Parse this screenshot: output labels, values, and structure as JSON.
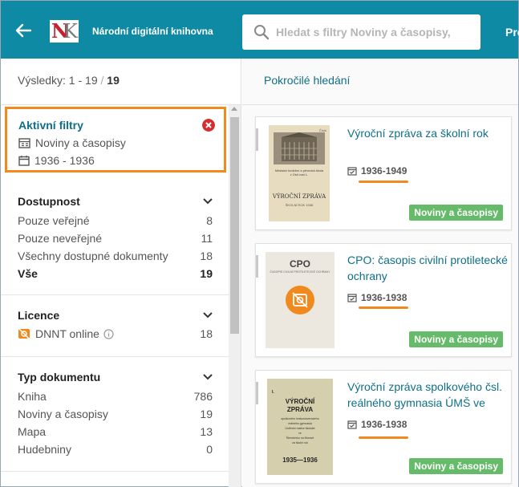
{
  "header": {
    "brand": "Národní digitální knihovna",
    "search_placeholder": "Hledat s filtry Noviny a časopisy,",
    "profile_label": "Pro"
  },
  "results": {
    "prefix": "Výsledky: 1 - 19",
    "separator": "/",
    "total": "19"
  },
  "advanced_search": "Pokročilé hledání",
  "active_filters": {
    "title": "Aktivní filtry",
    "items": [
      "Noviny a časopisy",
      "1936 - 1936"
    ]
  },
  "sections": {
    "availability": {
      "title": "Dostupnost",
      "items": [
        {
          "label": "Pouze veřejné",
          "count": "8"
        },
        {
          "label": "Pouze neveřejné",
          "count": "11"
        },
        {
          "label": "Všechny dostupné dokumenty",
          "count": "18"
        },
        {
          "label": "Vše",
          "count": "19"
        }
      ]
    },
    "license": {
      "title": "Licence",
      "items": [
        {
          "label": "DNNT online",
          "count": "18"
        }
      ]
    },
    "doctype": {
      "title": "Typ dokumentu",
      "items": [
        {
          "label": "Kniha",
          "count": "786"
        },
        {
          "label": "Noviny a časopisy",
          "count": "19"
        },
        {
          "label": "Mapa",
          "count": "13"
        },
        {
          "label": "Hudebniny",
          "count": "0"
        }
      ]
    }
  },
  "cards": [
    {
      "title": "Výroční zpráva za školní rok",
      "date": "1936-1949",
      "badge": "Noviny a časopisy",
      "thumb": {
        "corner": "Číslo",
        "lines": [
          "Městská hudební a pěvecká škola",
          "v Ústí nad L."
        ],
        "big": "VÝROČNÍ ZPRÁVA",
        "sub": "ŠKOLNÍ ROK 1936"
      }
    },
    {
      "title": "CPO: časopis civilní protiletecké ochrany",
      "date": "1936-1938",
      "badge": "Noviny a časopisy",
      "thumb": {
        "big": "CPO",
        "sub": "ČASOPIS CIVILNÍ PROTILETECKÉ OCHRANY"
      }
    },
    {
      "title": "Výroční zpráva spolkového čsl. reálného gymnasia ÚMŠ ve",
      "date": "1936-1938",
      "badge": "Noviny a časopisy",
      "thumb": {
        "corner": "I.",
        "big1": "VÝROČNÍ",
        "big2": "ZPRÁVA",
        "lines": [
          "spolkového československého",
          "reálného gymnasia",
          "Ústřední matice školské",
          "ve",
          "Šternberku na Moravě",
          "za školní rok"
        ],
        "year": "1935—1936"
      }
    }
  ],
  "colors": {
    "header": "#0f8aa4",
    "link": "#0f6f88",
    "accent": "#f08a1f",
    "badge": "#66bb6a",
    "close": "#d32f2f"
  }
}
